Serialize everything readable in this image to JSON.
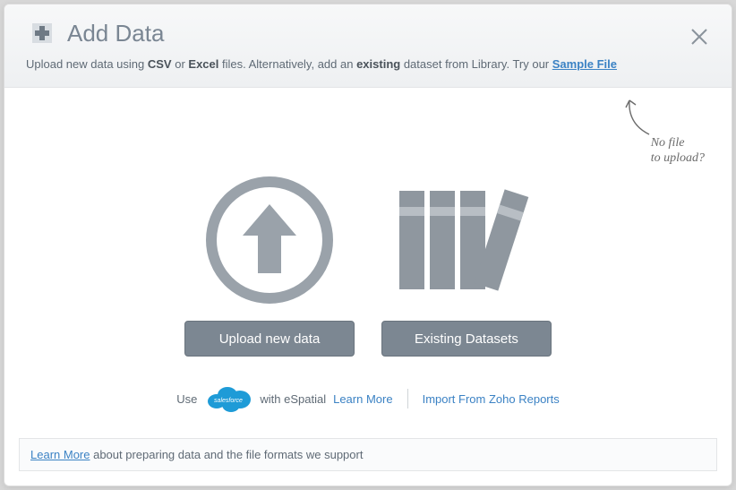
{
  "header": {
    "title": "Add Data",
    "subtitle_pre": "Upload new data using ",
    "csv": "CSV",
    "or": " or ",
    "excel": "Excel",
    "subtitle_mid": " files. Alternatively, add an ",
    "existing": "existing",
    "subtitle_post": " dataset from Library. Try our ",
    "sample_link": "Sample File"
  },
  "annotation": {
    "line1": "No file",
    "line2": "to upload?"
  },
  "buttons": {
    "upload": "Upload new data",
    "existing": "Existing Datasets"
  },
  "links": {
    "use": "Use",
    "espatial": " with eSpatial",
    "learn_more": "Learn More",
    "zoho": "Import From Zoho Reports"
  },
  "footer": {
    "learn_more": "Learn More",
    "rest": " about preparing data and the file formats we support"
  }
}
